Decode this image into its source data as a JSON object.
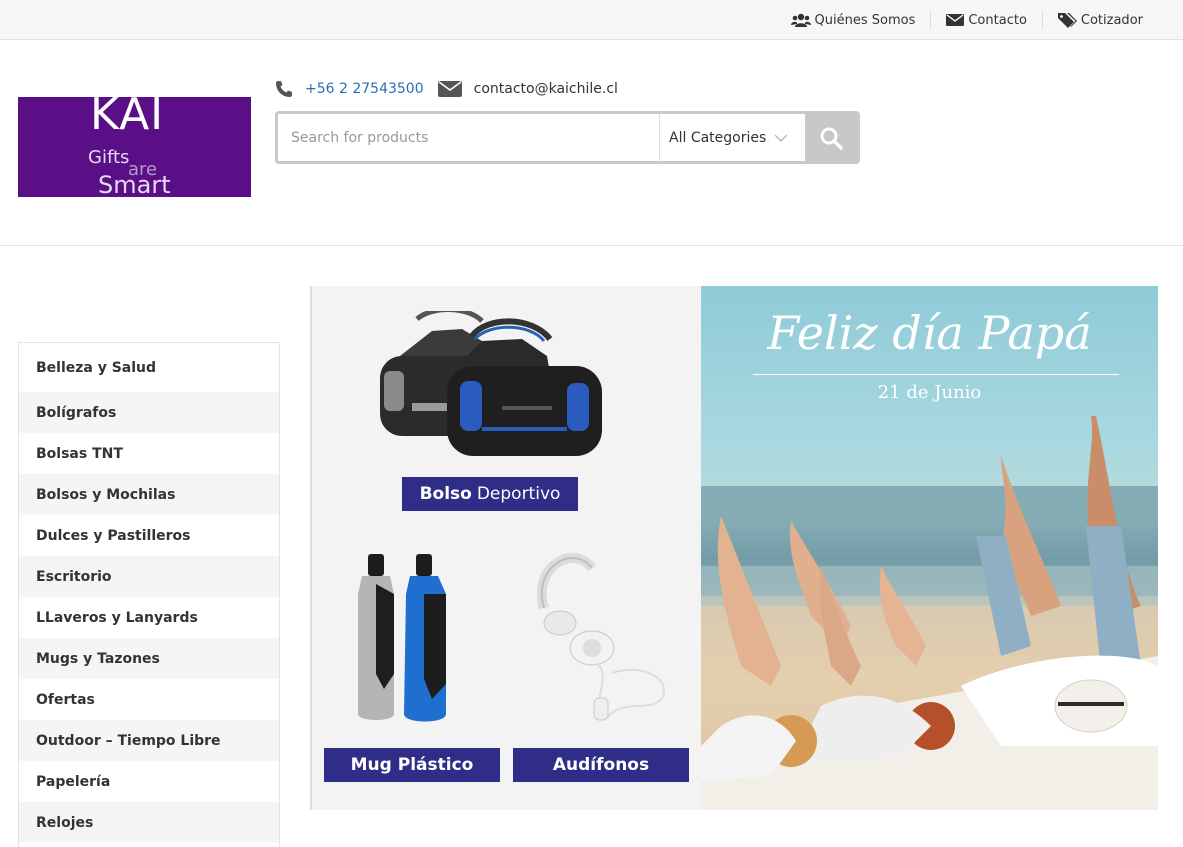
{
  "topbar": {
    "links": [
      {
        "label": "Quiénes Somos",
        "icon": "users-icon"
      },
      {
        "label": "Contacto",
        "icon": "envelope-icon"
      },
      {
        "label": "Cotizador",
        "icon": "tags-icon"
      }
    ]
  },
  "logo": {
    "line1": "KAI",
    "line2": "Gifts",
    "line3": "are",
    "line4": "Smart",
    "bg_color": "#5b0f86"
  },
  "contact": {
    "phone": "+56 2 27543500",
    "email": "contacto@kaichile.cl"
  },
  "search": {
    "placeholder": "Search for products",
    "category_selected": "All Categories"
  },
  "categories": [
    "Belleza y Salud",
    "Bolígrafos",
    "Bolsas TNT",
    "Bolsos y Mochilas",
    "Dulces y Pastilleros",
    "Escritorio",
    "LLaveros y Lanyards",
    "Mugs y Tazones",
    "Ofertas",
    "Outdoor – Tiempo Libre",
    "Papelería",
    "Relojes"
  ],
  "promo": {
    "bolso_bold": "Bolso",
    "bolso_rest": "Deportivo",
    "mug": "Mug Plástico",
    "audifonos": "Audífonos",
    "label_color": "#2f2d87"
  },
  "hero": {
    "title": "Feliz día Papá",
    "date": "21 de Junio"
  }
}
